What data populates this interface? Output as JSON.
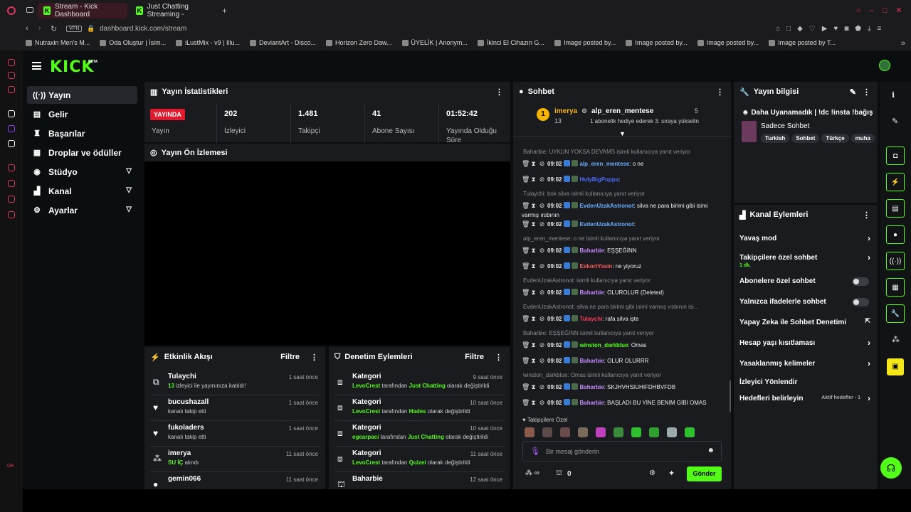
{
  "browser": {
    "tabs": [
      {
        "label": "Stream - Kick Dashboard"
      },
      {
        "label": "Just Chatting Streaming -"
      }
    ],
    "url": "dashboard.kick.com/stream",
    "vpn": "VPN",
    "bookmarks": [
      "Nutraxin Men's M...",
      "Oda Oluştur | İsim...",
      "iLustMix - v9 | Illu...",
      "DeviantArt - Disco...",
      "Horizon Zero Daw...",
      "ÜYELİK | Anonym...",
      "İkinci El Cihazın G...",
      "Image posted by...",
      "Image posted by...",
      "Image posted by...",
      "Image posted by T..."
    ]
  },
  "brand": {
    "logo": "KICK",
    "beta": "BETA"
  },
  "nav": [
    {
      "label": "Yayın",
      "icon": "broadcast-icon"
    },
    {
      "label": "Gelir",
      "icon": "revenue-icon"
    },
    {
      "label": "Başarılar",
      "icon": "trophy-icon"
    },
    {
      "label": "Droplar ve ödüller",
      "icon": "gift-icon"
    },
    {
      "label": "Stüdyo",
      "icon": "studio-icon"
    },
    {
      "label": "Kanal",
      "icon": "channel-icon"
    },
    {
      "label": "Ayarlar",
      "icon": "gear-icon"
    }
  ],
  "stats": {
    "title": "Yayın İstatistikleri",
    "live": "YAYINDA",
    "live_label": "Yayın",
    "items": [
      {
        "value": "202",
        "label": "İzleyici"
      },
      {
        "value": "1.481",
        "label": "Takipçi"
      },
      {
        "value": "41",
        "label": "Abone Sayısı"
      },
      {
        "value": "01:52:42",
        "label": "Yayında Olduğu Süre"
      }
    ]
  },
  "preview": {
    "title": "Yayın Ön İzlemesi"
  },
  "activity": {
    "title": "Etkinlik Akışı",
    "filter": "Filtre",
    "items": [
      {
        "name": "Tulaychi",
        "d1": "13",
        "d2": " izleyici ile yayınınıza katıldı!",
        "time": "1 saat önce"
      },
      {
        "name": "bucushazall",
        "d1": "",
        "d2": "kanalı takip etti",
        "time": "1 saat önce"
      },
      {
        "name": "fukoladers",
        "d1": "",
        "d2": "kanalı takip etti",
        "time": "1 saat önce"
      },
      {
        "name": "imerya",
        "d1": "SU İÇ",
        "d2": " alındı",
        "time": "11 saat önce"
      },
      {
        "name": "gemin066",
        "d1": "",
        "d2": "",
        "time": "11 saat önce"
      }
    ]
  },
  "mod": {
    "title": "Denetim Eylemleri",
    "filter": "Filtre",
    "items": [
      {
        "name": "Kategori",
        "user": "LevoCrest",
        "mid": " tarafından ",
        "cat": "Just Chatting",
        "end": " olarak değiştirildi",
        "time": "9 saat önce"
      },
      {
        "name": "Kategori",
        "user": "LevoCrest",
        "mid": " tarafından ",
        "cat": "Hades",
        "end": " olarak değiştirildi",
        "time": "10 saat önce"
      },
      {
        "name": "Kategori",
        "user": "egearpaci",
        "mid": " tarafından ",
        "cat": "Just Chatting",
        "end": " olarak değiştirildi",
        "time": "10 saat önce"
      },
      {
        "name": "Kategori",
        "user": "LevoCrest",
        "mid": " tarafından ",
        "cat": "Quizei",
        "end": " olarak değiştirildi",
        "time": "11 saat önce"
      },
      {
        "name": "Baharbie",
        "user": "",
        "mid": "",
        "cat": "",
        "end": "",
        "time": "12 saat önce"
      }
    ]
  },
  "chat": {
    "title": "Sohbet",
    "gift_user": "imerya",
    "gift_count": "13",
    "gift_target": "alp_eren_mentese",
    "gift_num": "5",
    "gift_text": "1 abonelik hediye ederek 3. sıraya yükselin",
    "messages": [
      {
        "reply": "Baharbie: UYKUN YOKSA DEVAMS isimli kullanıcıya yanıt veriyor",
        "time": "09:02",
        "user": "alp_eren_mentese",
        "color": "#6ab0ff",
        "text": ": o ne"
      },
      {
        "reply": "",
        "time": "09:02",
        "user": "HolyBigPoppa",
        "color": "#4f6bff",
        "text": ":"
      },
      {
        "reply": "Tulaychi: bok silva isimli kullanıcıya yanıt veriyor",
        "time": "09:02",
        "user": "EvdenUzakAstronot",
        "color": "#6ab0ff",
        "text": ": silva ne para birimi gibi isimi varmış ırsbının"
      },
      {
        "reply": "",
        "time": "09:02",
        "user": "EvdenUzakAstronot",
        "color": "#6ab0ff",
        "text": ":"
      },
      {
        "reply": "alp_eren_mentese: o ne isimli kullanıcıya yanıt veriyor",
        "time": "09:02",
        "user": "Baharbie",
        "color": "#c58cff",
        "text": ": EŞŞEĞİNN"
      },
      {
        "reply": "",
        "time": "09:02",
        "user": "EskortYasin",
        "color": "#ff5a5a",
        "text": ": ne yiyoruz"
      },
      {
        "reply": "EvdenUzakAstronot: isimli kullanıcıya yanıt veriyor",
        "time": "09:02",
        "user": "Baharbie",
        "color": "#c58cff",
        "text": ": OLUROLUR (Deleted)"
      },
      {
        "reply": "EvdenUzakAstronot: silva ne para birimi gibi isimi varmış ırsbının isi...",
        "time": "09:02",
        "user": "Tulaychi",
        "color": "#ff3b5c",
        "text": ": rafa silva işte"
      },
      {
        "reply": "Baharbie: EŞŞEĞİNN isimli kullanıcıya yanıt veriyor",
        "time": "09:02",
        "user": "winston_darkblue",
        "color": "#53fc18",
        "text": ": Omas"
      },
      {
        "reply": "",
        "time": "09:02",
        "user": "Baharbie",
        "color": "#c58cff",
        "text": ": OLUR OLURRR"
      },
      {
        "reply": "winston_darkblue: Omas isimli kullanıcıya yanıt veriyor",
        "time": "09:02",
        "user": "Baharbie",
        "color": "#c58cff",
        "text": ": SKJHVHSIUHIFDHBVFDB"
      },
      {
        "reply": "",
        "time": "09:02",
        "user": "Baharbie",
        "color": "#c58cff",
        "text": ": BAŞLADI BU YİNE BENİM GİBİ OMAS DEMEYE"
      }
    ],
    "followers_only": "Takipçilere Özel",
    "input_placeholder": "Bir mesaj gönderin",
    "points": "0",
    "send": "Gönder"
  },
  "info": {
    "title": "Yayın bilgisi",
    "stream_title": "Daha Uyanamadık | !dc !insta !bağış",
    "category": "Sadece Sohbet",
    "tags": [
      "Turkish",
      "Sohbet",
      "Türkçe",
      "muha"
    ]
  },
  "channel_actions": {
    "title": "Kanal Eylemleri",
    "items": [
      {
        "label": "Yavaş mod",
        "type": "chevron"
      },
      {
        "label": "Takipçilere özel sohbet",
        "sub": "1 dk.",
        "type": "chevron"
      },
      {
        "label": "Abonelere özel sohbet",
        "type": "toggle"
      },
      {
        "label": "Yalnızca ifadelerle sohbet",
        "type": "toggle"
      },
      {
        "label": "Yapay Zeka ile Sohbet Denetimi",
        "type": "external"
      },
      {
        "label": "Hesap yaşı kısıtlaması",
        "type": "chevron"
      },
      {
        "label": "Yasaklanmış kelimeler",
        "type": "chevron"
      },
      {
        "label": "İzleyici Yönlendir",
        "type": "none"
      },
      {
        "label": "Hedefleri belirleyin",
        "sub": "Aktif hedefler - 1",
        "type": "chevron"
      }
    ]
  },
  "colors": {
    "accent": "#53fc18",
    "live": "#e01a2c",
    "panel": "#191b1f"
  }
}
